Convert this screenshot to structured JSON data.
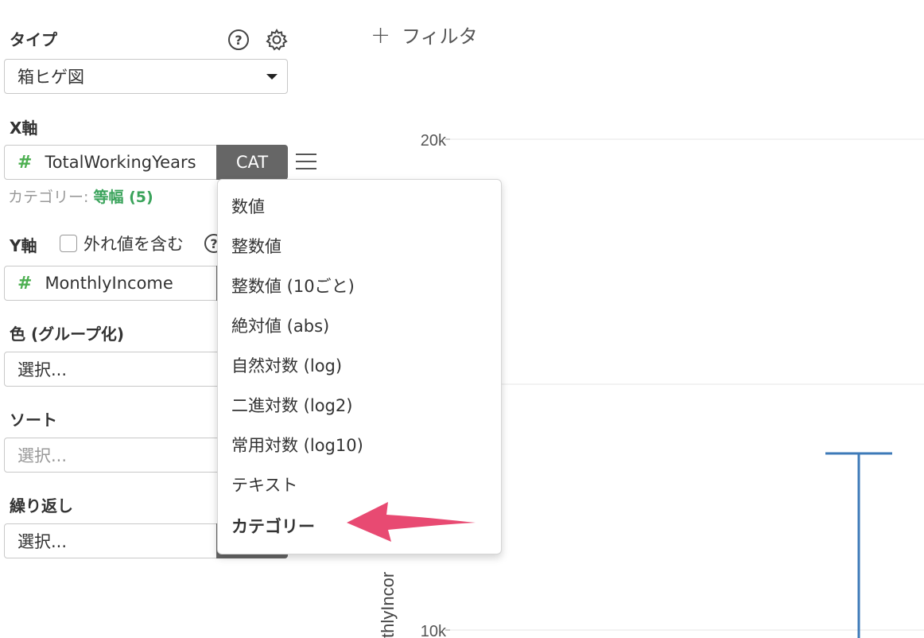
{
  "sidebar": {
    "type": {
      "label": "タイプ",
      "value": "箱ヒゲ図"
    },
    "x_axis": {
      "label": "X軸",
      "field_symbol": "#",
      "field": "TotalWorkingYears",
      "type_button": "CAT",
      "category_prefix": "カテゴリー: ",
      "category_value": "等幅 (5)"
    },
    "y_axis": {
      "label": "Y軸",
      "outlier_checkbox_label": "外れ値を含む",
      "field_symbol": "#",
      "field": "MonthlyIncome"
    },
    "color": {
      "label": "色 (グループ化)",
      "value": "選択..."
    },
    "sort": {
      "label": "ソート",
      "placeholder": "選択..."
    },
    "repeat": {
      "label": "繰り返し",
      "value": "選択..."
    }
  },
  "icons": {
    "help": "?",
    "settings": "gear-icon",
    "y_help": "?"
  },
  "filter": {
    "plus": "+",
    "label": "フィルタ"
  },
  "menu": {
    "items": [
      "数値",
      "整数値",
      "整数値 (10ごと)",
      "絶対値 (abs)",
      "自然対数 (log)",
      "二進対数 (log2)",
      "常用対数 (log10)",
      "テキスト",
      "カテゴリー"
    ],
    "selected": "カテゴリー",
    "arrow_color": "#e84a72"
  },
  "chart_data": {
    "type": "box",
    "ylabel_visible": "thlyIncor",
    "y_ticks": [
      "20k",
      "10k"
    ],
    "whisker_color": "#3d7ab8"
  }
}
